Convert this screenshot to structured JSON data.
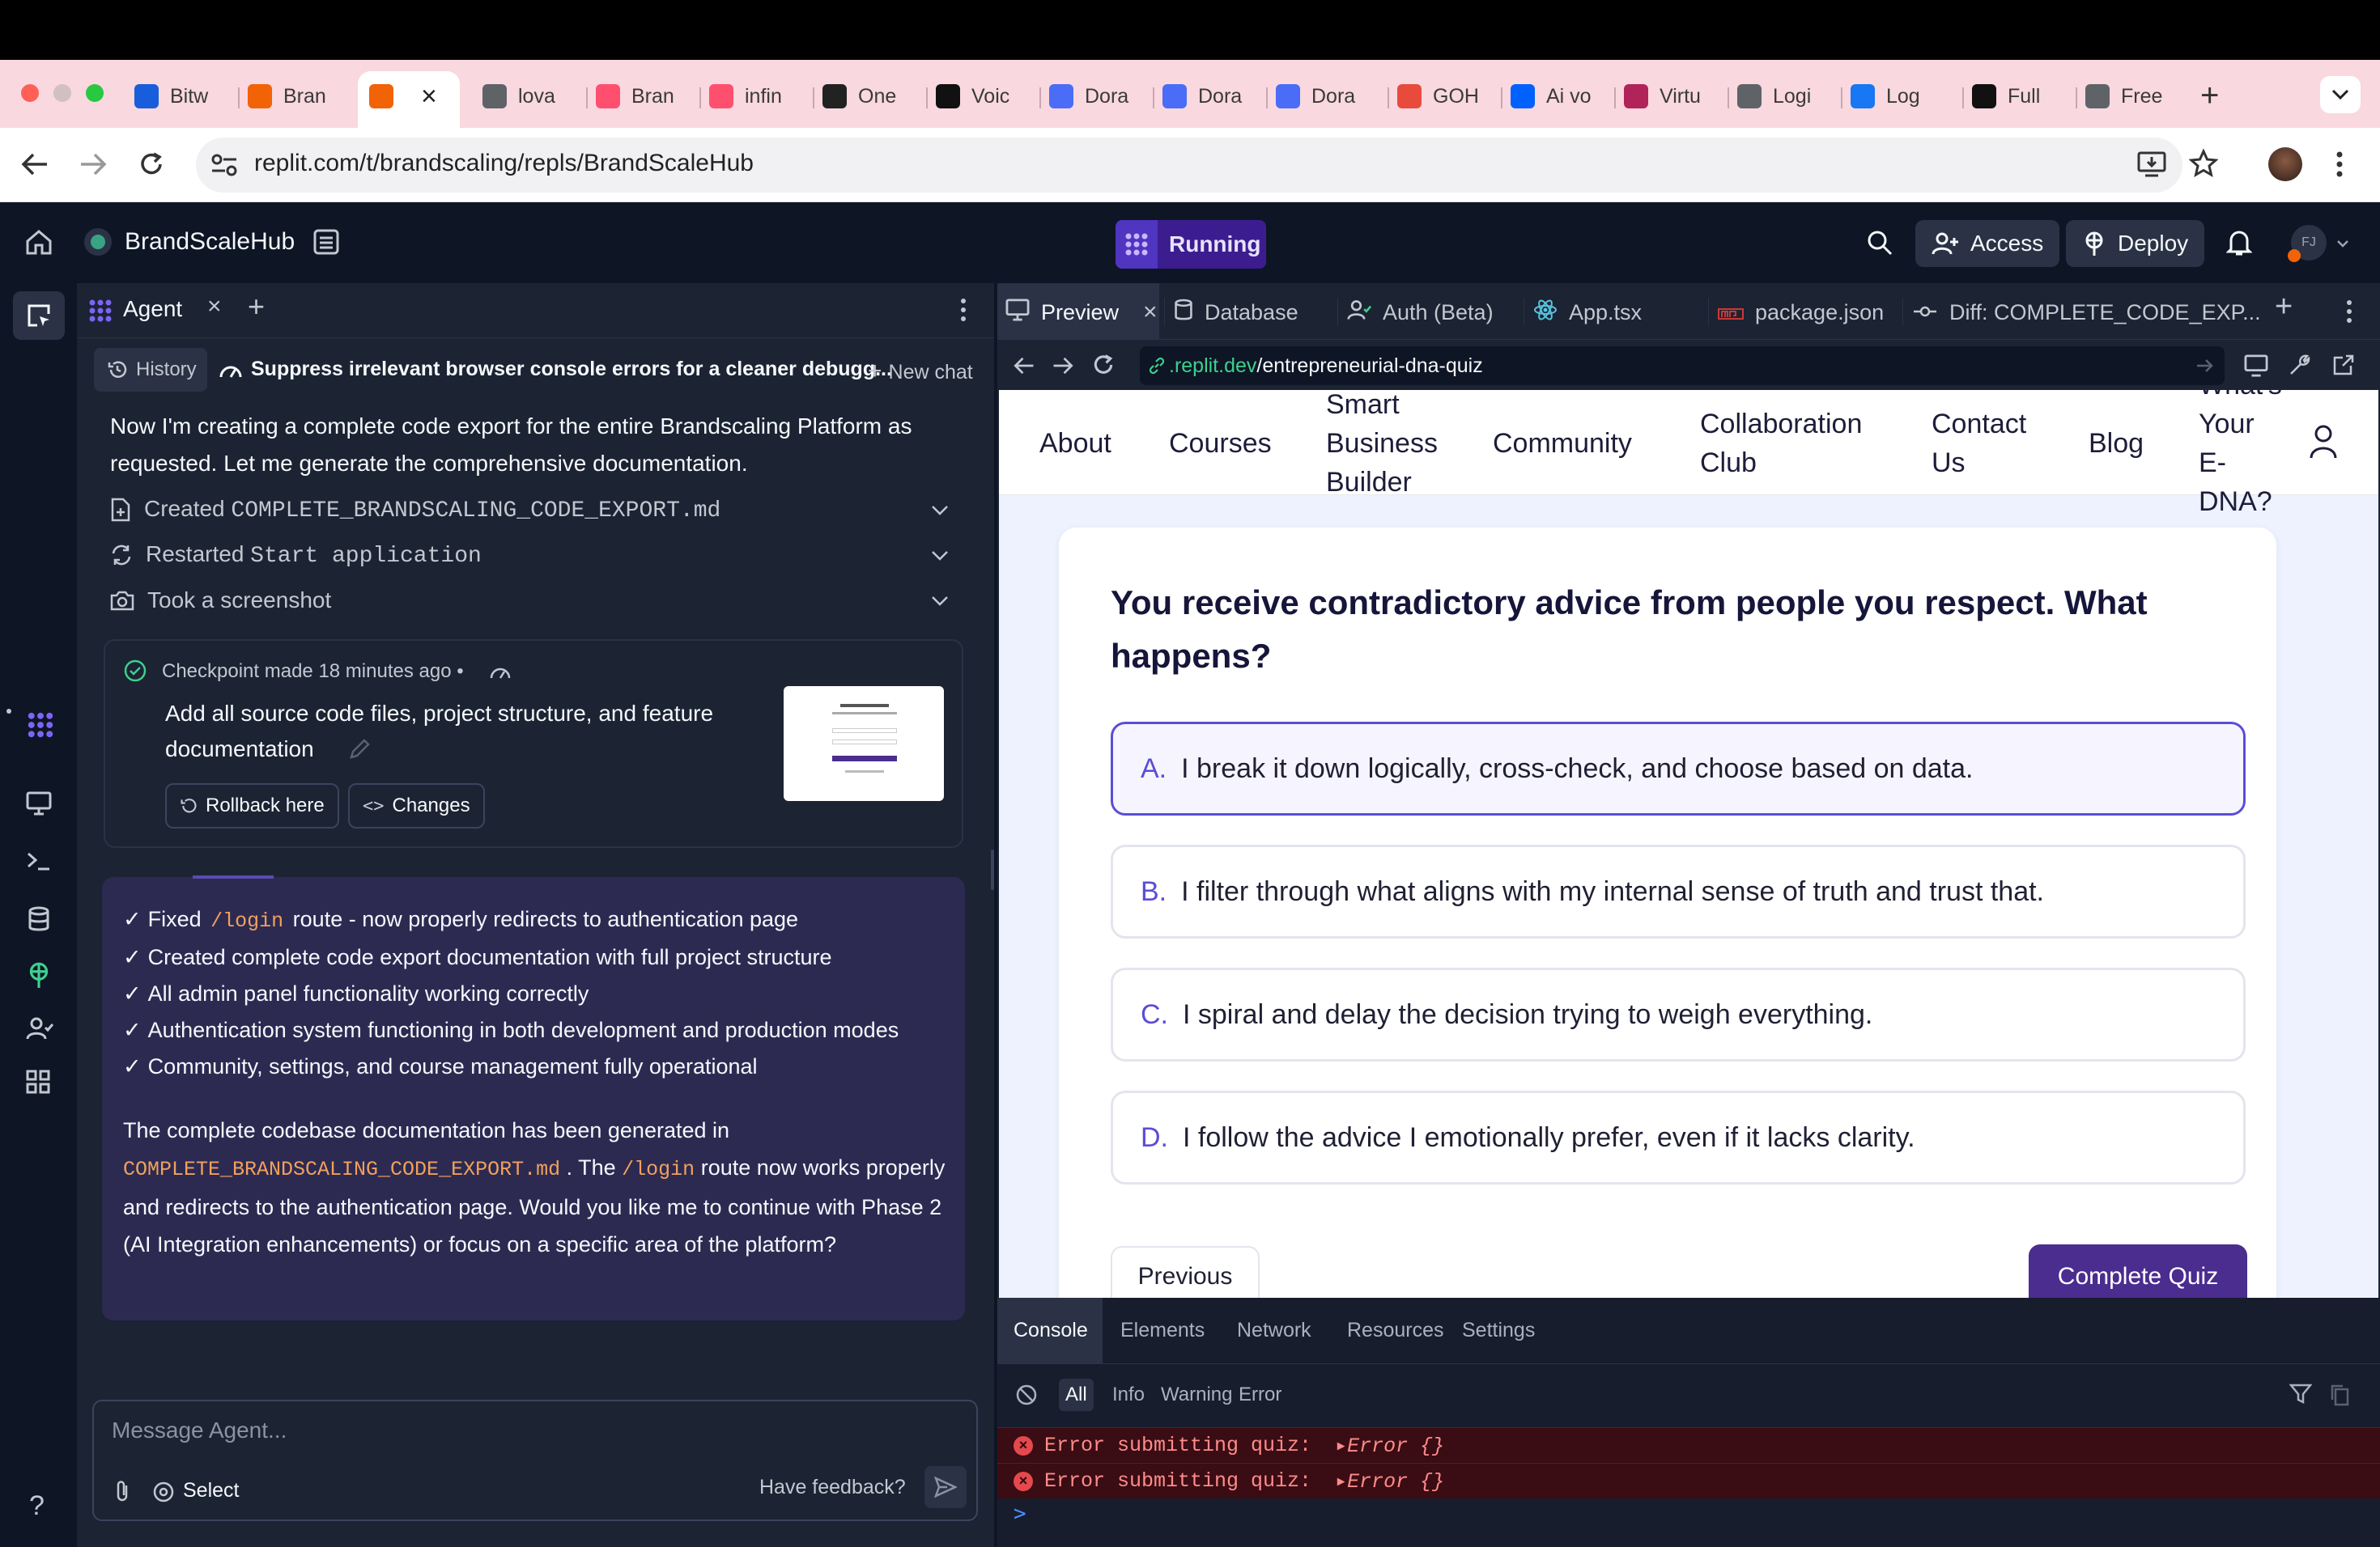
{
  "browser": {
    "tabs": [
      {
        "label": "Bitw",
        "icon": "bitwarden-icon",
        "color": "#175ddc"
      },
      {
        "label": "Bran",
        "icon": "replit-icon",
        "color": "#f26207"
      },
      {
        "label": "",
        "icon": "replit-icon",
        "color": "#f26207"
      },
      {
        "label": "lova",
        "icon": "globe-icon",
        "color": "#5f6368"
      },
      {
        "label": "Bran",
        "icon": "lovable-icon",
        "color": "#ff4f6e"
      },
      {
        "label": "infin",
        "icon": "lovable-icon",
        "color": "#ff4f6e"
      },
      {
        "label": "One",
        "icon": "openai-icon",
        "color": "#222222"
      },
      {
        "label": "Voic",
        "icon": "pause-icon",
        "color": "#111111"
      },
      {
        "label": "Dora",
        "icon": "dora-icon",
        "color": "#4a6cf7"
      },
      {
        "label": "Dora",
        "icon": "dora-icon",
        "color": "#4a6cf7"
      },
      {
        "label": "Dora",
        "icon": "dora-icon",
        "color": "#4a6cf7"
      },
      {
        "label": "GOH",
        "icon": "gohighlevel-icon",
        "color": "#e84b3c"
      },
      {
        "label": "Ai vo",
        "icon": "dropbox-icon",
        "color": "#0061fe"
      },
      {
        "label": "Virtu",
        "icon": "virtual-icon",
        "color": "#b0245a"
      },
      {
        "label": "Logi",
        "icon": "globe-icon",
        "color": "#5f6368"
      },
      {
        "label": "Log",
        "icon": "facebook-icon",
        "color": "#1877f2"
      },
      {
        "label": "Full",
        "icon": "upwork-icon",
        "color": "#111111"
      },
      {
        "label": "Free",
        "icon": "globe-icon",
        "color": "#5f6368"
      }
    ],
    "url": "replit.com/t/brandscaling/repls/BrandScaleHub"
  },
  "app": {
    "project_name": "BrandScaleHub",
    "status": "Running",
    "access_label": "Access",
    "deploy_label": "Deploy",
    "avatar_initials": "FJ"
  },
  "agent": {
    "tab_label": "Agent",
    "history_label": "History",
    "chat_title": "Suppress irrelevant browser console errors for a cleaner debugg...",
    "new_chat_label": "New chat",
    "intro_text": "Now I'm creating a complete code export for the entire Brandscaling Platform as requested. Let me generate the comprehensive documentation.",
    "steps": [
      {
        "prefix": "Created ",
        "code": "COMPLETE_BRANDSCALING_CODE_EXPORT.md"
      },
      {
        "prefix": "Restarted ",
        "code": "Start application"
      },
      {
        "prefix": "Took a screenshot",
        "code": ""
      }
    ],
    "checkpoint": {
      "meta": "Checkpoint made 18 minutes ago",
      "dot": "•",
      "text": "Add all source code files, project structure, and feature documentation",
      "rollback_label": "Rollback here",
      "changes_label": "Changes"
    },
    "summary": {
      "checks": [
        {
          "mark": "✓",
          "pre": "Fixed ",
          "code": "/login",
          "post": " route - now properly redirects to authentication page"
        },
        {
          "mark": "✓",
          "pre": "Created complete code export documentation with full project structure",
          "code": "",
          "post": ""
        },
        {
          "mark": "✓",
          "pre": "All admin panel functionality working correctly",
          "code": "",
          "post": ""
        },
        {
          "mark": "✓",
          "pre": "Authentication system functioning in both development and production modes",
          "code": "",
          "post": ""
        },
        {
          "mark": "✓",
          "pre": "Community, settings, and course management fully operational",
          "code": "",
          "post": ""
        }
      ],
      "para_pre": "The complete codebase documentation has been generated in",
      "para_code1": "COMPLETE_BRANDSCALING_CODE_EXPORT.md",
      "para_mid1": ". The",
      "para_code2": "/login",
      "para_mid2": "route now works properly and redirects to the authentication page. Would you like me to continue with Phase 2 (AI Integration enhancements) or focus on a specific area of the platform?"
    },
    "input_placeholder": "Message Agent...",
    "select_label": "Select",
    "feedback_label": "Have feedback?"
  },
  "workspace": {
    "tabs": [
      {
        "label": "Preview",
        "icon": "monitor-icon"
      },
      {
        "label": "Database",
        "icon": "database-icon"
      },
      {
        "label": "Auth (Beta)",
        "icon": "user-check-icon"
      },
      {
        "label": "App.tsx",
        "icon": "react-icon"
      },
      {
        "label": "package.json",
        "icon": "npm-icon"
      },
      {
        "label": "Diff: COMPLETE_CODE_EXP...",
        "icon": "diff-icon"
      }
    ],
    "preview_url_domain": ".replit.dev",
    "preview_url_path": "/entrepreneurial-dna-quiz"
  },
  "site": {
    "nav": [
      "About",
      "Courses",
      "Smart Business Builder",
      "Community",
      "Collaboration Club",
      "Contact Us",
      "Blog",
      "What's Your E-DNA?"
    ],
    "question": "You receive contradictory advice from people you respect. What happens?",
    "options": [
      {
        "letter": "A.",
        "text": "I break it down logically, cross-check, and choose based on data."
      },
      {
        "letter": "B.",
        "text": "I filter through what aligns with my internal sense of truth and trust that."
      },
      {
        "letter": "C.",
        "text": "I spiral and delay the decision trying to weigh everything."
      },
      {
        "letter": "D.",
        "text": "I follow the advice I emotionally prefer, even if it lacks clarity."
      }
    ],
    "selected_option": "A.",
    "previous_label": "Previous",
    "complete_label": "Complete Quiz",
    "accent_color": "#4b2c8f"
  },
  "devtools": {
    "tabs": [
      "Console",
      "Elements",
      "Network",
      "Resources",
      "Settings"
    ],
    "filters": [
      "All",
      "Info",
      "Warning",
      "Error"
    ],
    "errors": [
      {
        "text": "Error submitting quiz: ",
        "obj": "▸Error {}"
      },
      {
        "text": "Error submitting quiz: ",
        "obj": "▸Error {}"
      }
    ],
    "prompt": ">"
  }
}
